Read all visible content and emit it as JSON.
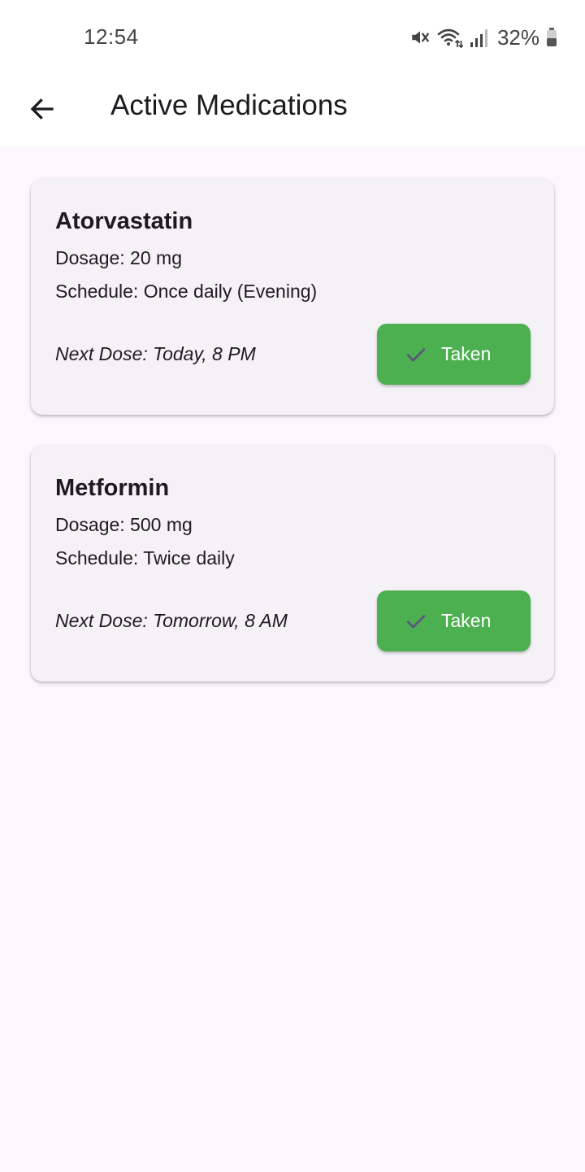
{
  "status_bar": {
    "time": "12:54",
    "battery": "32%",
    "icons": [
      "mute-icon",
      "wifi-icon",
      "signal-icon",
      "battery-icon"
    ]
  },
  "app_bar": {
    "back_icon": "arrow-left-icon",
    "title": "Active Medications"
  },
  "colors": {
    "accent": "#4caf50",
    "card_background": "#f4f1f7",
    "page_background": "#fcf7fd",
    "check_icon": "#5b5580"
  },
  "medications": [
    {
      "name": "Atorvastatin",
      "dosage": "Dosage: 20 mg",
      "schedule": "Schedule: Once daily (Evening)",
      "next_dose": "Next Dose: Today, 8 PM",
      "button_label": "Taken",
      "button_icon": "check-icon"
    },
    {
      "name": "Metformin",
      "dosage": "Dosage: 500 mg",
      "schedule": "Schedule: Twice daily",
      "next_dose": "Next Dose: Tomorrow, 8 AM",
      "button_label": "Taken",
      "button_icon": "check-icon"
    }
  ]
}
